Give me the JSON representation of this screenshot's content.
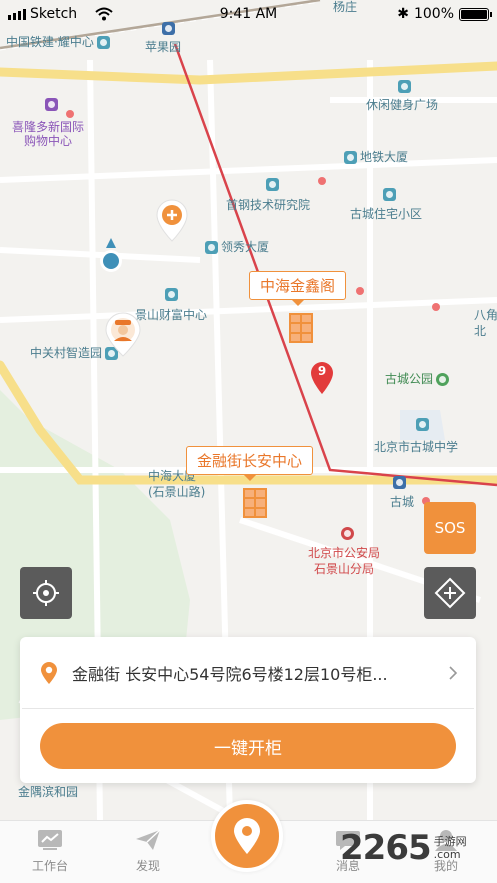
{
  "status_bar": {
    "carrier": "Sketch",
    "time": "9:41 AM",
    "battery": "100%"
  },
  "map": {
    "pois": {
      "zhongguo_tiejian": "中国铁建·耀中心",
      "pingguoyuan": "苹果园",
      "yangzhuang": "杨庄",
      "xilong_line1": "喜隆多新国际",
      "xilong_line2": "购物中心",
      "xiuxian": "休闲健身广场",
      "ditie_dasha": "地铁大厦",
      "shougang": "首钢技术研究院",
      "gucheng_zhuzhai": "古城住宅小区",
      "lingxiu": "领秀大厦",
      "jingshan_caifu": "景山财富中心",
      "zhongguancun": "中关村智造园",
      "gucheng_park": "古城公园",
      "gucheng_school": "北京市古城中学",
      "zhonghai_dasha_line1": "中海大厦",
      "zhonghai_dasha_line2": "(石景山路)",
      "gucheng_station": "古城",
      "police_line1": "北京市公安局",
      "police_line2": "石景山分局",
      "jinyu": "金隅滨和园",
      "edge_right_1": "八角",
      "edge_right_2": "北"
    },
    "markers": {
      "zhonghai_jinxin": "中海金鑫阁",
      "jinrongjie_changan": "金融街长安中心",
      "red_pin_number": "9"
    }
  },
  "controls": {
    "sos_label": "SOS"
  },
  "card": {
    "address": "金融街 长安中心54号院6号楼12层10号柜...",
    "open_button": "一键开柜"
  },
  "tabbar": {
    "workbench": "工作台",
    "discover": "发现",
    "messages": "消息",
    "mine": "我的"
  },
  "watermark": {
    "number": "2265",
    "site_line1": "手游网",
    "site_line2": ".com"
  },
  "colors": {
    "accent": "#f0913c",
    "route": "#d9434b",
    "poi_text": "#4b7d8e"
  }
}
